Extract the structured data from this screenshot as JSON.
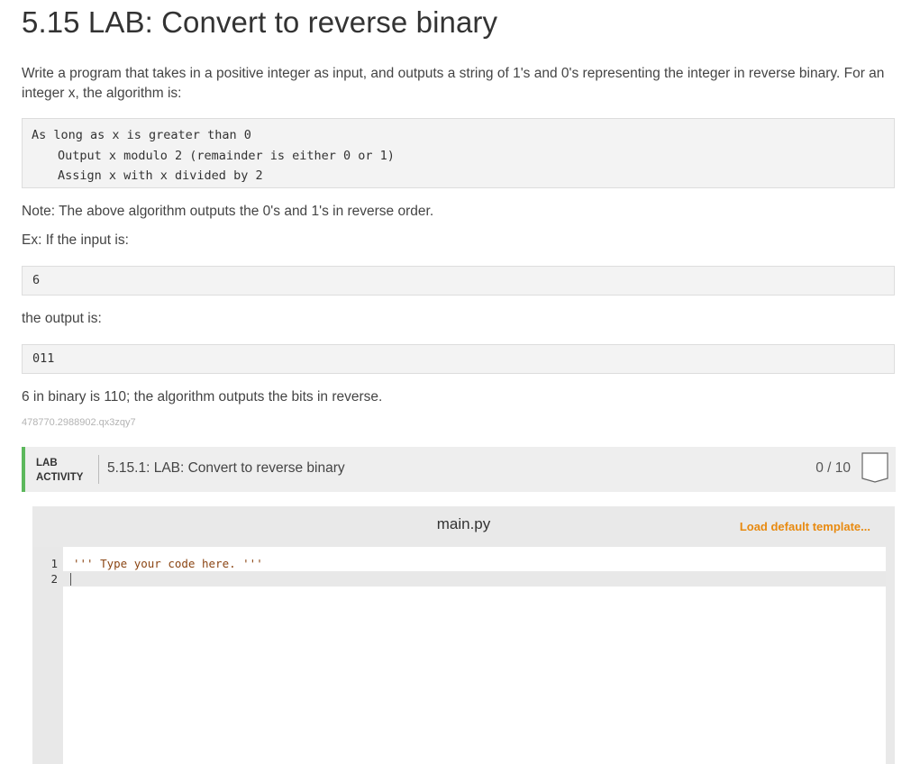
{
  "page": {
    "title": "5.15 LAB: Convert to reverse binary",
    "intro": "Write a program that takes in a positive integer as input, and outputs a string of 1's and 0's representing the integer in reverse binary. For an integer x, the algorithm is:",
    "algorithm": [
      "As long as x is greater than 0",
      "Output x modulo 2 (remainder is either 0 or 1)",
      "Assign x with x divided by 2"
    ],
    "note": "Note: The above algorithm outputs the 0's and 1's in reverse order.",
    "example_label": "Ex: If the input is:",
    "example_input": "6",
    "output_label": "the output is:",
    "example_output": "011",
    "explanation": "6 in binary is 110; the algorithm outputs the bits in reverse.",
    "content_id": "478770.2988902.qx3zqy7"
  },
  "lab": {
    "tag_line1": "LAB",
    "tag_line2": "ACTIVITY",
    "title": "5.15.1: LAB: Convert to reverse binary",
    "score": "0 / 10",
    "accent_color": "#5cb85c"
  },
  "editor": {
    "filename": "main.py",
    "load_template": "Load default template...",
    "lines": [
      {
        "number": "1",
        "code": "''' Type your code here. '''"
      },
      {
        "number": "2",
        "code": ""
      }
    ]
  }
}
